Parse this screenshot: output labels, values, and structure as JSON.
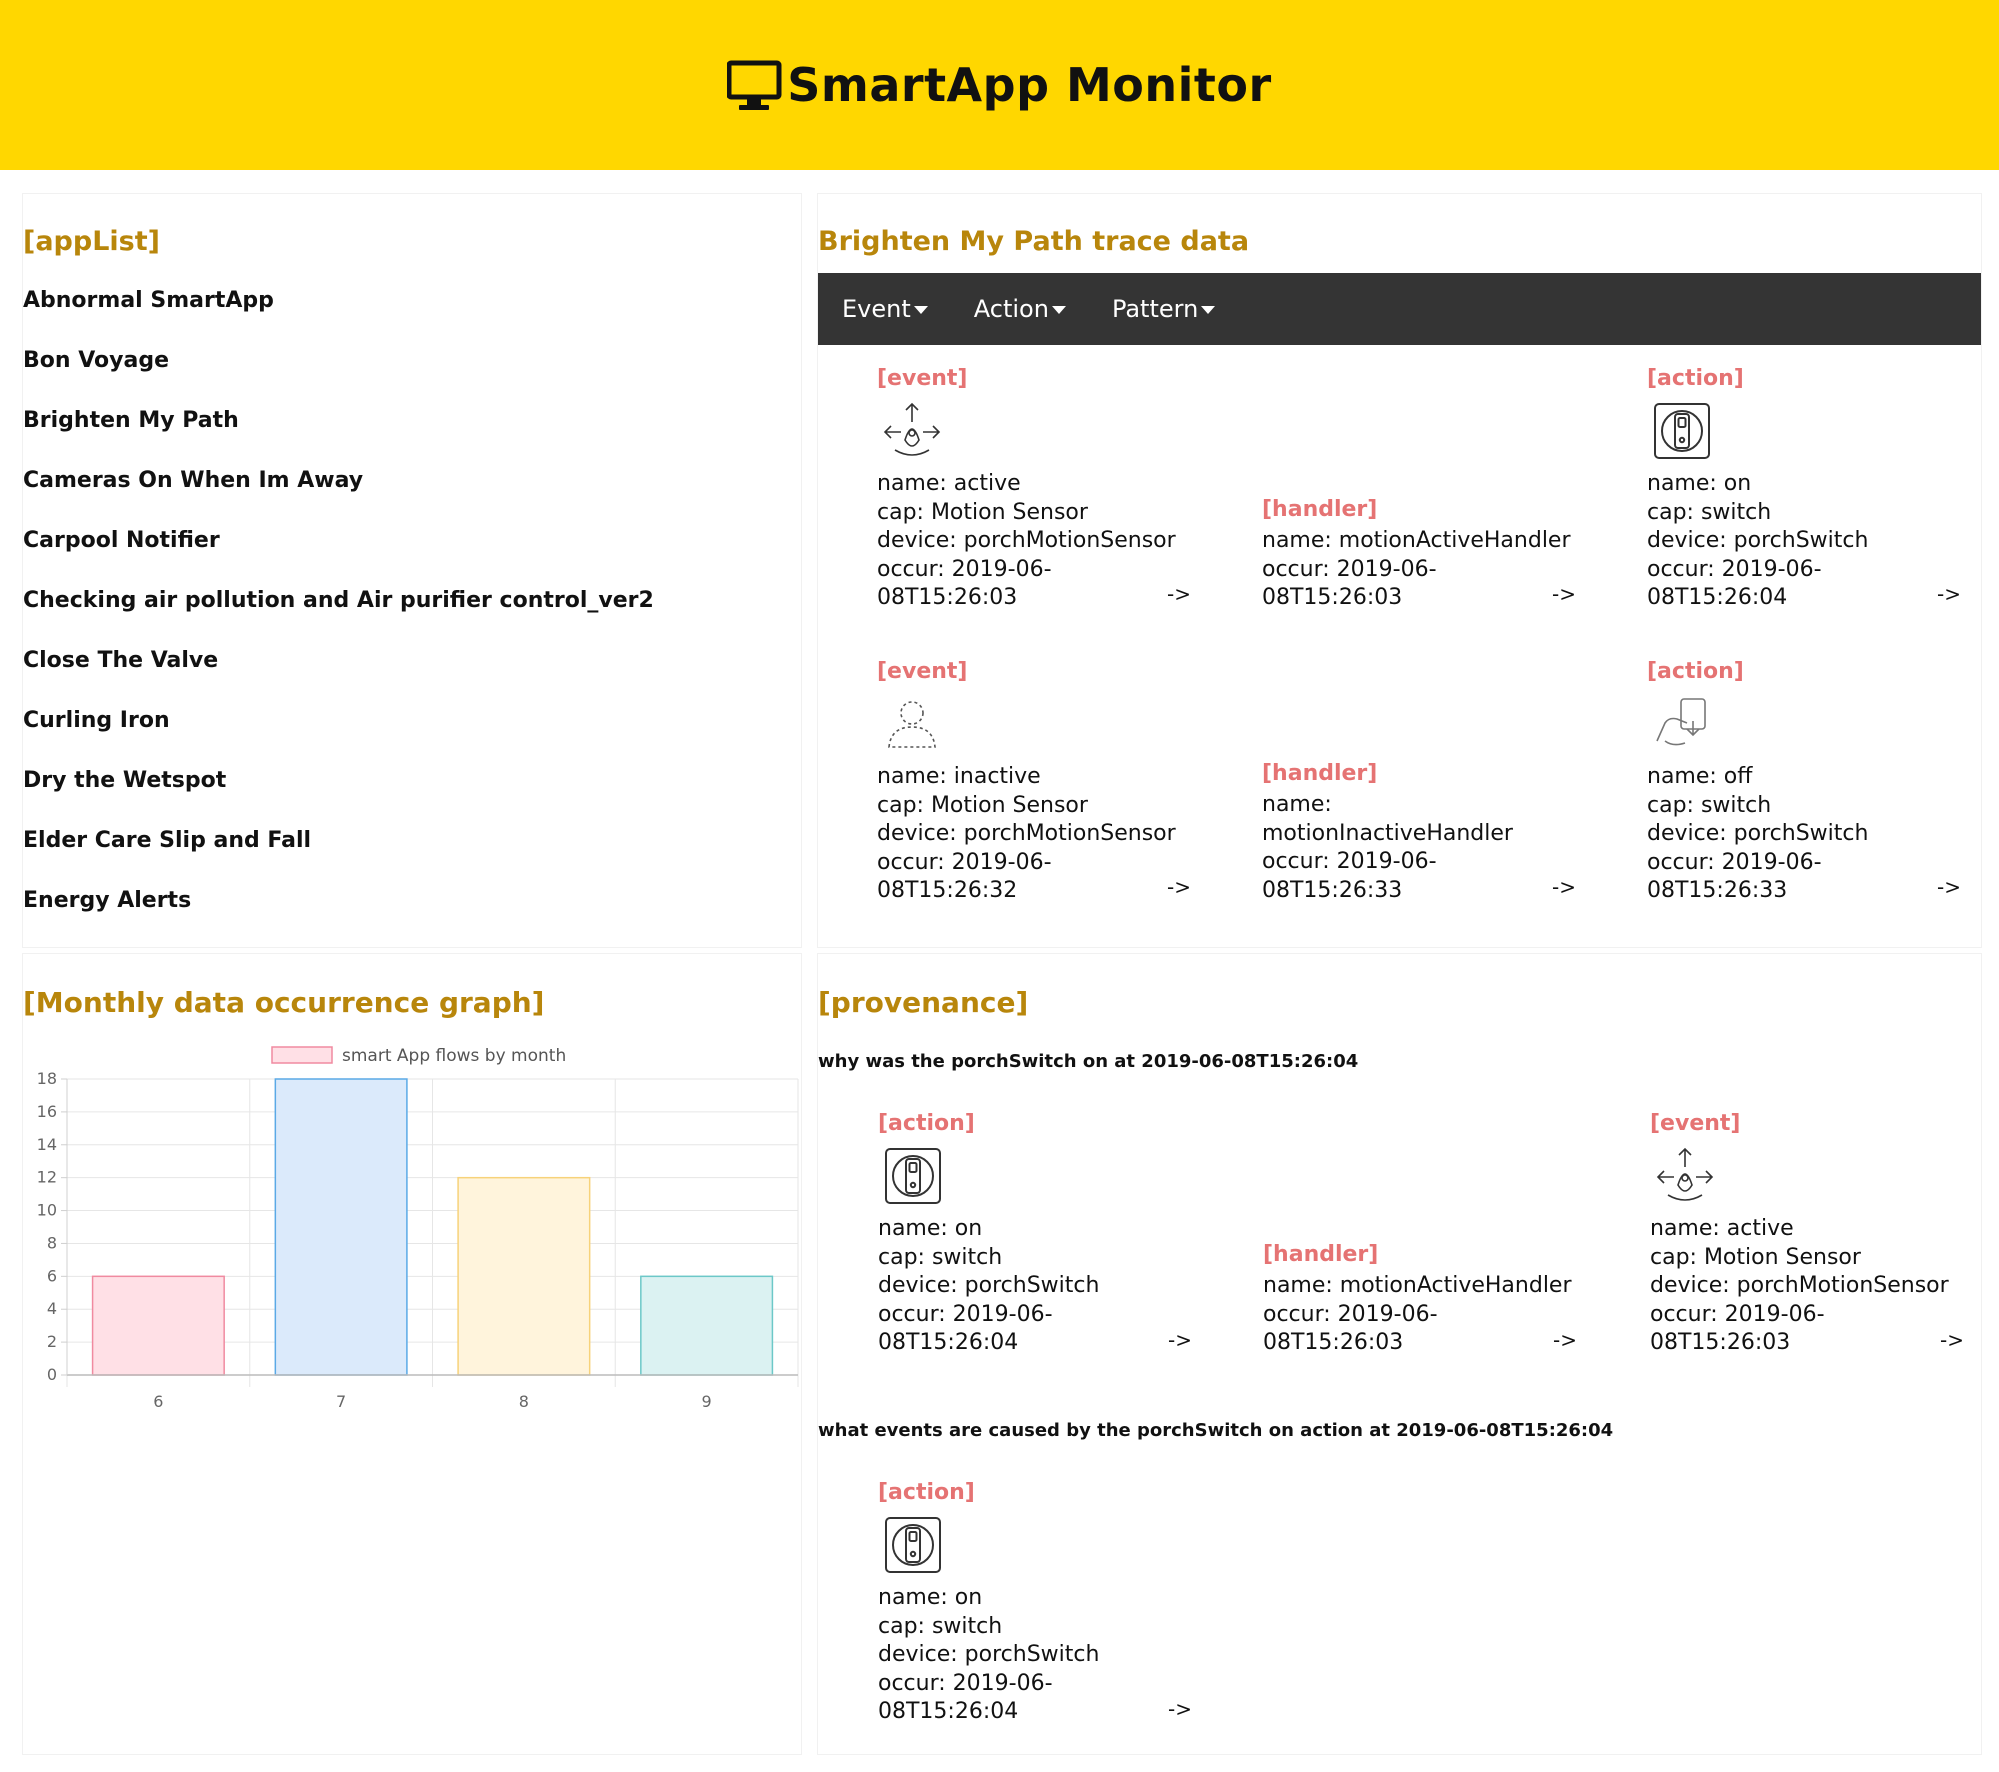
{
  "header": {
    "title": "SmartApp Monitor",
    "icon": "monitor-icon"
  },
  "applist": {
    "title": "[appList]",
    "items": [
      "Abnormal SmartApp",
      "Bon Voyage",
      "Brighten My Path",
      "Cameras On When Im Away",
      "Carpool Notifier",
      "Checking air pollution and Air purifier control_ver2",
      "Close The Valve",
      "Curling Iron",
      "Dry the Wetspot",
      "Elder Care Slip and Fall",
      "Energy Alerts"
    ]
  },
  "trace": {
    "title": "Brighten My Path trace data",
    "nav": [
      "Event",
      "Action",
      "Pattern"
    ],
    "rows": [
      [
        {
          "label": "[event]",
          "icon": "motion-sensor-icon",
          "lines": [
            "name: active",
            "cap: Motion Sensor",
            "device: porchMotionSensor",
            "occur: 2019-06-",
            "08T15:26:03"
          ],
          "arrow": "->"
        },
        {
          "label": "[handler]",
          "lines": [
            "name: motionActiveHandler",
            "occur: 2019-06-",
            "08T15:26:03"
          ],
          "arrow": "->"
        },
        {
          "label": "[action]",
          "icon": "switch-icon",
          "lines": [
            "name: on",
            "cap: switch",
            "device: porchSwitch",
            "occur: 2019-06-",
            "08T15:26:04"
          ],
          "arrow": "->"
        }
      ],
      [
        {
          "label": "[event]",
          "icon": "presence-icon",
          "lines": [
            "name: inactive",
            "cap: Motion Sensor",
            "device: porchMotionSensor",
            "occur: 2019-06-",
            "08T15:26:32"
          ],
          "arrow": "->"
        },
        {
          "label": "[handler]",
          "lines": [
            "name:",
            "motionInactiveHandler",
            "occur: 2019-06-",
            "08T15:26:33"
          ],
          "arrow": "->"
        },
        {
          "label": "[action]",
          "icon": "hand-switch-icon",
          "lines": [
            "name: off",
            "cap: switch",
            "device: porchSwitch",
            "occur: 2019-06-",
            "08T15:26:33"
          ],
          "arrow": "->"
        }
      ]
    ]
  },
  "graph": {
    "title": "[Monthly data occurrence graph]"
  },
  "chart_data": {
    "type": "bar",
    "title": "",
    "legend": "smart App flows by month",
    "legend_position": "top",
    "categories": [
      "6",
      "7",
      "8",
      "9"
    ],
    "series": [
      {
        "name": "smart App flows by month",
        "values": [
          6,
          18,
          12,
          6
        ]
      }
    ],
    "colors_fill": [
      "#ffe0e6",
      "#dbeafb",
      "#fff4dc",
      "#dbf2f2"
    ],
    "colors_stroke": [
      "#f08aa0",
      "#5aa9e6",
      "#f7d27a",
      "#6cc8c8"
    ],
    "ylim": [
      0,
      18
    ],
    "yticks": [
      0,
      2,
      4,
      6,
      8,
      10,
      12,
      14,
      16,
      18
    ],
    "grid": true,
    "xlabel": "",
    "ylabel": ""
  },
  "provenance": {
    "title": "[provenance]",
    "q1": "why was the porchSwitch on at 2019-06-08T15:26:04",
    "q1_cards": [
      {
        "label": "[action]",
        "icon": "switch-icon",
        "lines": [
          "name: on",
          "cap: switch",
          "device: porchSwitch",
          "occur: 2019-06-",
          "08T15:26:04"
        ],
        "arrow": "->"
      },
      {
        "label": "[handler]",
        "lines": [
          "name: motionActiveHandler",
          "occur: 2019-06-",
          "08T15:26:03"
        ],
        "arrow": "->"
      },
      {
        "label": "[event]",
        "icon": "motion-sensor-icon",
        "lines": [
          "name: active",
          "cap: Motion Sensor",
          "device: porchMotionSensor",
          "occur: 2019-06-",
          "08T15:26:03"
        ],
        "arrow": "->"
      }
    ],
    "q2": "what events are caused by the porchSwitch on action at 2019-06-08T15:26:04",
    "q2_cards": [
      {
        "label": "[action]",
        "icon": "switch-icon",
        "lines": [
          "name: on",
          "cap: switch",
          "device: porchSwitch",
          "occur: 2019-06-",
          "08T15:26:04"
        ],
        "arrow": "->"
      }
    ]
  }
}
